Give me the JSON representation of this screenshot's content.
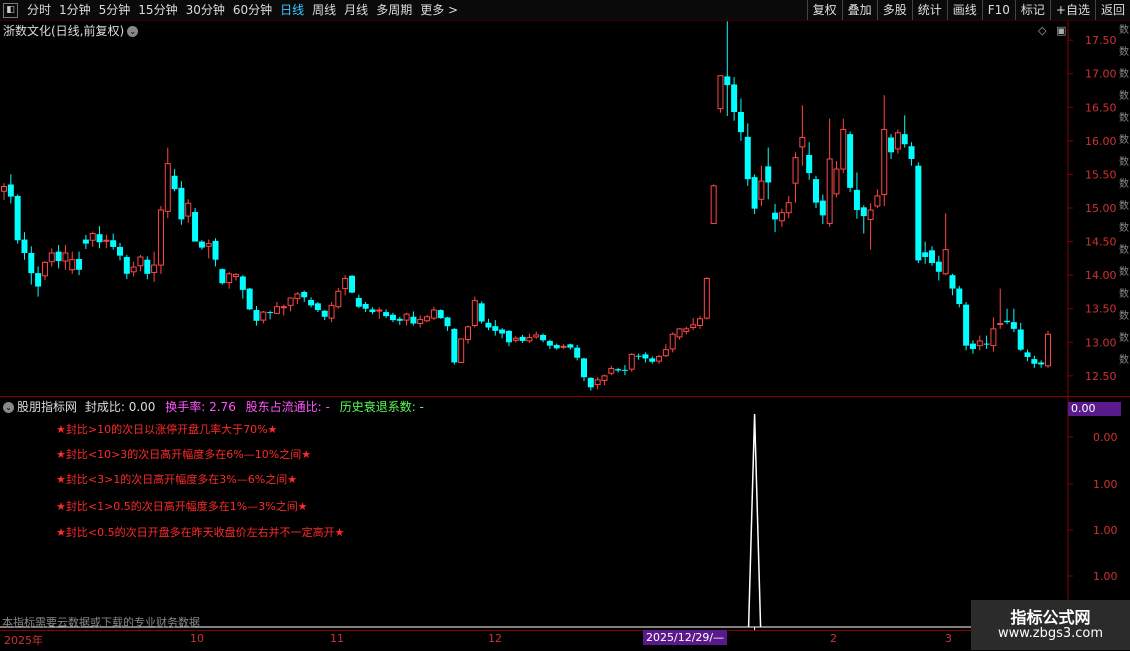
{
  "toolbar": {
    "periods": [
      "分时",
      "1分钟",
      "5分钟",
      "15分钟",
      "30分钟",
      "60分钟",
      "日线",
      "周线",
      "月线",
      "多周期",
      "更多 >"
    ],
    "active_index": 6,
    "tools": [
      "复权",
      "叠加",
      "多股",
      "统计",
      "画线",
      "F10",
      "标记",
      "+自选",
      "返回"
    ]
  },
  "main": {
    "title": "浙数文化(日线,前复权)",
    "price_labels": [
      "17.50",
      "17.00",
      "16.50",
      "16.00",
      "15.50",
      "15.00",
      "14.50",
      "14.00",
      "13.50",
      "13.00",
      "12.50"
    ]
  },
  "side_strip": [
    "数",
    "数",
    "数",
    "数",
    "数",
    "数",
    "数",
    "数",
    "数",
    "数",
    "数",
    "数",
    "数",
    "数",
    "数",
    "数"
  ],
  "indicator": {
    "name": "股朋指标网",
    "fengcheng": "封成比: 0.00",
    "huanshou": "换手率: 2.76",
    "gudong": "股东占流通比: -",
    "lishi": "历史衰退系数: -",
    "badge": "0.00",
    "axis_labels": [
      "0.00",
      "1.00",
      "1.00",
      "1.00",
      "1.00"
    ],
    "notes": [
      "★封比>10的次日以涨停开盘几率大于70%★",
      "★封比<10>3的次日高开幅度多在6%—10%之间★",
      "★封比<3>1的次日高开幅度多在3%—6%之间★",
      "★封比<1>0.5的次日高开幅度多在1%—3%之间★",
      "★封比<0.5的次日开盘多在昨天收盘价左右并不一定高开★"
    ],
    "disclaimer": "本指标需要云数据或下载的专业财务数据"
  },
  "time_axis": {
    "labels": [
      "2025年",
      "10",
      "11",
      "12",
      "2",
      "3"
    ],
    "cursor_date": "2025/12/29/—"
  },
  "watermark": {
    "line1": "指标公式网",
    "line2": "www.zbgs3.com"
  },
  "colors": {
    "up": "#ff4646",
    "down": "#00ffff",
    "background": "#000000",
    "grid_red": "#8a0000",
    "highlight": "#5a1a8c"
  },
  "chart_data": {
    "type": "candlestick",
    "ylim": [
      12.2,
      17.8
    ],
    "candles": [
      [
        15.25,
        15.32,
        15.12,
        15.37
      ],
      [
        15.35,
        15.17,
        15.07,
        15.5
      ],
      [
        15.18,
        14.52,
        14.47,
        15.2
      ],
      [
        14.53,
        14.33,
        14.23,
        14.64
      ],
      [
        14.33,
        14.03,
        13.86,
        14.43
      ],
      [
        14.03,
        13.83,
        13.68,
        14.13
      ],
      [
        13.99,
        14.19,
        13.93,
        14.21
      ],
      [
        14.2,
        14.33,
        14.13,
        14.4
      ],
      [
        14.35,
        14.21,
        14.1,
        14.45
      ],
      [
        14.21,
        14.33,
        14.08,
        14.45
      ],
      [
        14.08,
        14.23,
        14.02,
        14.35
      ],
      [
        14.24,
        14.08,
        14.0,
        14.35
      ],
      [
        14.53,
        14.47,
        14.39,
        14.6
      ],
      [
        14.52,
        14.62,
        14.42,
        14.65
      ],
      [
        14.61,
        14.49,
        14.4,
        14.73
      ],
      [
        14.52,
        14.52,
        14.4,
        14.6
      ],
      [
        14.52,
        14.42,
        14.38,
        14.62
      ],
      [
        14.42,
        14.29,
        14.22,
        14.48
      ],
      [
        14.27,
        14.02,
        13.94,
        14.3
      ],
      [
        14.05,
        14.12,
        13.98,
        14.2
      ],
      [
        14.14,
        14.27,
        14.06,
        14.3
      ],
      [
        14.23,
        14.02,
        13.94,
        14.28
      ],
      [
        14.04,
        14.15,
        13.9,
        14.35
      ],
      [
        14.15,
        14.97,
        14.02,
        15.03
      ],
      [
        14.95,
        15.66,
        14.85,
        15.9
      ],
      [
        15.48,
        15.28,
        15.25,
        15.58
      ],
      [
        15.3,
        14.83,
        14.75,
        15.4
      ],
      [
        14.88,
        15.07,
        14.78,
        15.13
      ],
      [
        14.94,
        14.5,
        14.5,
        15.0
      ],
      [
        14.5,
        14.41,
        14.38,
        14.52
      ],
      [
        14.43,
        14.47,
        14.25,
        14.53
      ],
      [
        14.51,
        14.23,
        14.13,
        14.55
      ],
      [
        14.09,
        13.88,
        13.86,
        14.1
      ],
      [
        13.89,
        14.02,
        13.8,
        14.05
      ],
      [
        13.98,
        14.01,
        13.92,
        14.03
      ],
      [
        13.98,
        13.78,
        13.65,
        14.0
      ],
      [
        13.8,
        13.49,
        13.48,
        13.81
      ],
      [
        13.48,
        13.32,
        13.25,
        13.54
      ],
      [
        13.33,
        13.45,
        13.28,
        13.47
      ],
      [
        13.45,
        13.44,
        13.34,
        13.47
      ],
      [
        13.43,
        13.53,
        13.42,
        13.6
      ],
      [
        13.52,
        13.53,
        13.4,
        13.56
      ],
      [
        13.55,
        13.66,
        13.46,
        13.66
      ],
      [
        13.65,
        13.72,
        13.57,
        13.75
      ],
      [
        13.75,
        13.67,
        13.6,
        13.77
      ],
      [
        13.63,
        13.55,
        13.52,
        13.67
      ],
      [
        13.58,
        13.48,
        13.45,
        13.6
      ],
      [
        13.47,
        13.38,
        13.33,
        13.48
      ],
      [
        13.36,
        13.55,
        13.3,
        13.6
      ],
      [
        13.53,
        13.76,
        13.5,
        13.81
      ],
      [
        13.8,
        13.95,
        13.7,
        14.0
      ],
      [
        13.99,
        13.74,
        13.73,
        14.0
      ],
      [
        13.66,
        13.53,
        13.51,
        13.71
      ],
      [
        13.57,
        13.5,
        13.45,
        13.6
      ],
      [
        13.49,
        13.45,
        13.42,
        13.52
      ],
      [
        13.47,
        13.48,
        13.35,
        13.52
      ],
      [
        13.45,
        13.39,
        13.36,
        13.49
      ],
      [
        13.41,
        13.33,
        13.3,
        13.44
      ],
      [
        13.35,
        13.32,
        13.26,
        13.38
      ],
      [
        13.33,
        13.42,
        13.25,
        13.44
      ],
      [
        13.38,
        13.28,
        13.25,
        13.46
      ],
      [
        13.28,
        13.34,
        13.22,
        13.4
      ],
      [
        13.32,
        13.38,
        13.3,
        13.41
      ],
      [
        13.36,
        13.48,
        13.33,
        13.53
      ],
      [
        13.48,
        13.36,
        13.35,
        13.49
      ],
      [
        13.37,
        13.24,
        13.17,
        13.38
      ],
      [
        13.2,
        12.7,
        12.67,
        13.21
      ],
      [
        12.7,
        13.05,
        12.69,
        13.06
      ],
      [
        13.04,
        13.23,
        12.98,
        13.25
      ],
      [
        13.25,
        13.62,
        13.22,
        13.68
      ],
      [
        13.58,
        13.31,
        13.28,
        13.61
      ],
      [
        13.29,
        13.22,
        13.18,
        13.35
      ],
      [
        13.24,
        13.17,
        13.1,
        13.33
      ],
      [
        13.19,
        13.13,
        13.06,
        13.21
      ],
      [
        13.17,
        13.0,
        12.94,
        13.18
      ],
      [
        13.03,
        13.06,
        13.0,
        13.09
      ],
      [
        13.08,
        13.02,
        12.99,
        13.11
      ],
      [
        13.02,
        13.07,
        12.99,
        13.13
      ],
      [
        13.08,
        13.11,
        13.05,
        13.16
      ],
      [
        13.11,
        13.03,
        13.0,
        13.13
      ],
      [
        13.02,
        12.95,
        12.9,
        13.04
      ],
      [
        12.96,
        12.91,
        12.89,
        12.98
      ],
      [
        12.93,
        12.94,
        12.9,
        12.97
      ],
      [
        12.97,
        12.92,
        12.89,
        12.98
      ],
      [
        12.92,
        12.77,
        12.73,
        12.96
      ],
      [
        12.76,
        12.48,
        12.42,
        12.77
      ],
      [
        12.47,
        12.33,
        12.28,
        12.48
      ],
      [
        12.37,
        12.44,
        12.3,
        12.48
      ],
      [
        12.43,
        12.5,
        12.36,
        12.52
      ],
      [
        12.54,
        12.61,
        12.51,
        12.65
      ],
      [
        12.6,
        12.58,
        12.55,
        12.62
      ],
      [
        12.59,
        12.58,
        12.51,
        12.66
      ],
      [
        12.6,
        12.82,
        12.56,
        12.84
      ],
      [
        12.8,
        12.79,
        12.74,
        12.83
      ],
      [
        12.82,
        12.76,
        12.7,
        12.85
      ],
      [
        12.76,
        12.71,
        12.68,
        12.79
      ],
      [
        12.72,
        12.79,
        12.68,
        12.81
      ],
      [
        12.8,
        12.89,
        12.78,
        12.97
      ],
      [
        12.9,
        13.12,
        12.85,
        13.15
      ],
      [
        13.08,
        13.2,
        13.04,
        13.21
      ],
      [
        13.16,
        13.2,
        13.12,
        13.23
      ],
      [
        13.22,
        13.26,
        13.18,
        13.36
      ],
      [
        13.25,
        13.35,
        13.2,
        13.39
      ],
      [
        13.36,
        13.95,
        13.34,
        13.97
      ],
      [
        14.77,
        15.33,
        14.77,
        15.35
      ],
      [
        16.48,
        16.97,
        16.42,
        16.98
      ],
      [
        16.96,
        16.83,
        16.37,
        17.78
      ],
      [
        16.84,
        16.43,
        16.3,
        16.95
      ],
      [
        16.43,
        16.13,
        16.0,
        16.63
      ],
      [
        16.06,
        15.43,
        15.33,
        16.26
      ],
      [
        15.46,
        14.99,
        14.91,
        15.5
      ],
      [
        15.13,
        15.4,
        15.03,
        15.63
      ],
      [
        15.62,
        15.38,
        15.13,
        15.9
      ],
      [
        14.93,
        14.83,
        14.64,
        15.06
      ],
      [
        14.81,
        14.93,
        14.72,
        14.99
      ],
      [
        14.93,
        15.08,
        14.85,
        15.18
      ],
      [
        15.37,
        15.75,
        15.08,
        15.83
      ],
      [
        15.91,
        16.05,
        15.63,
        16.53
      ],
      [
        15.79,
        15.52,
        15.42,
        15.98
      ],
      [
        15.43,
        15.08,
        15.0,
        15.48
      ],
      [
        15.11,
        14.89,
        14.76,
        15.2
      ],
      [
        14.77,
        15.73,
        14.72,
        16.33
      ],
      [
        15.21,
        15.58,
        15.16,
        15.7
      ],
      [
        15.58,
        16.17,
        15.52,
        16.33
      ],
      [
        16.1,
        15.3,
        15.24,
        16.14
      ],
      [
        15.27,
        14.97,
        14.84,
        15.53
      ],
      [
        15.01,
        14.88,
        14.62,
        15.04
      ],
      [
        14.83,
        14.97,
        14.38,
        15.07
      ],
      [
        15.03,
        15.18,
        15.0,
        15.28
      ],
      [
        15.2,
        16.17,
        15.03,
        16.68
      ],
      [
        16.05,
        15.83,
        15.73,
        16.1
      ],
      [
        15.88,
        16.12,
        15.81,
        16.17
      ],
      [
        16.1,
        15.95,
        15.9,
        16.38
      ],
      [
        15.92,
        15.73,
        15.63,
        15.98
      ],
      [
        15.63,
        14.22,
        14.18,
        15.68
      ],
      [
        14.34,
        14.27,
        14.17,
        14.5
      ],
      [
        14.37,
        14.18,
        14.14,
        14.43
      ],
      [
        14.2,
        14.05,
        13.92,
        14.29
      ],
      [
        14.02,
        14.38,
        14.0,
        14.92
      ],
      [
        14.0,
        13.8,
        13.7,
        14.02
      ],
      [
        13.8,
        13.57,
        13.52,
        13.84
      ],
      [
        13.56,
        12.95,
        12.88,
        13.6
      ],
      [
        12.98,
        12.9,
        12.83,
        13.03
      ],
      [
        12.95,
        13.02,
        12.88,
        13.1
      ],
      [
        12.98,
        12.97,
        12.9,
        13.1
      ],
      [
        12.95,
        13.2,
        12.86,
        13.37
      ],
      [
        13.28,
        13.28,
        13.2,
        13.8
      ],
      [
        13.32,
        13.3,
        13.27,
        13.5
      ],
      [
        13.3,
        13.2,
        13.15,
        13.5
      ],
      [
        13.19,
        12.89,
        12.87,
        13.29
      ],
      [
        12.85,
        12.78,
        12.72,
        12.89
      ],
      [
        12.75,
        12.68,
        12.62,
        12.8
      ],
      [
        12.7,
        12.67,
        12.62,
        12.73
      ],
      [
        12.65,
        13.12,
        12.62,
        13.17
      ]
    ],
    "indicator_series_peak": 1.0
  }
}
